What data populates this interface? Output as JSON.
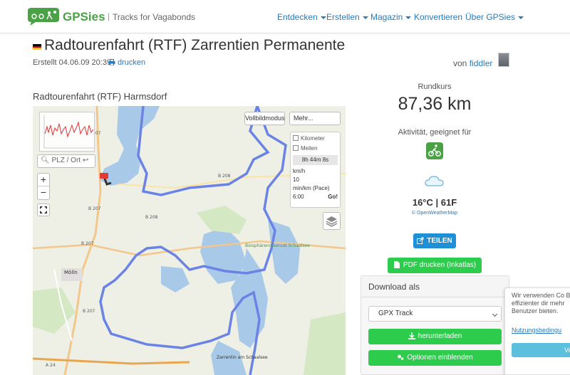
{
  "header": {
    "brand": "GPSies",
    "separator": "|",
    "tagline": "Tracks for Vagabonds",
    "nav": [
      "Entdecken",
      "Erstellen",
      "Magazin",
      "Konvertieren",
      "Über GPSies"
    ]
  },
  "track": {
    "title": "Radtourenfahrt (RTF)  Zarrentien Permanente",
    "created": "Erstellt 04.06.09 20:39",
    "print_label": "drucken",
    "author_prefix": "von",
    "author": "fiddler",
    "map_title": "Radtourenfahrt (RTF) Harmsdorf"
  },
  "map": {
    "search_placeholder": "PLZ / Ort ↩",
    "zoom_in": "+",
    "zoom_out": "−",
    "fullscreen_label": "Vollbildmodus",
    "more_label": "Mehr...",
    "unit_km": "Kilometer",
    "unit_mi": "Meilen",
    "duration": "8h 44m 8s",
    "speed_unit": "km/h",
    "speed_value": "10",
    "pace_unit": "min/km (Pace)",
    "pace_value": "6:00",
    "go_label": "Go!",
    "place_labels": [
      "Mölln",
      "Zarrentin am Schaalsee",
      "Biosphärenreservat Schaalsee"
    ],
    "road_labels": [
      "B 207",
      "B 207",
      "B 208",
      "B 208",
      "B 207",
      "B 207",
      "A 24"
    ]
  },
  "stats": {
    "route_type": "Rundkurs",
    "distance": "87,36 km",
    "activity_label": "Aktivität, geeignet für",
    "weather": "16°C | 61F",
    "weather_source": "© OpenWeatherMap"
  },
  "actions": {
    "share": "TEILEN",
    "pdf": "PDF drucken (Inkatlas)"
  },
  "download": {
    "heading": "Download als",
    "format_selected": "GPX Track",
    "download_label": "herunterladen",
    "options_label": "Optionen einblenden"
  },
  "cookie": {
    "text": "Wir verwenden Co Besuch effizienter dir mehr Benutzer bieten.",
    "link": "Nutzungsbedingu",
    "button": "Ver"
  },
  "colors": {
    "brand_green": "#4aa146",
    "link_blue": "#2a7ab8",
    "route_blue": "#6c83e6",
    "button_green": "#2ecc4d",
    "button_blue": "#1f8fd6"
  }
}
